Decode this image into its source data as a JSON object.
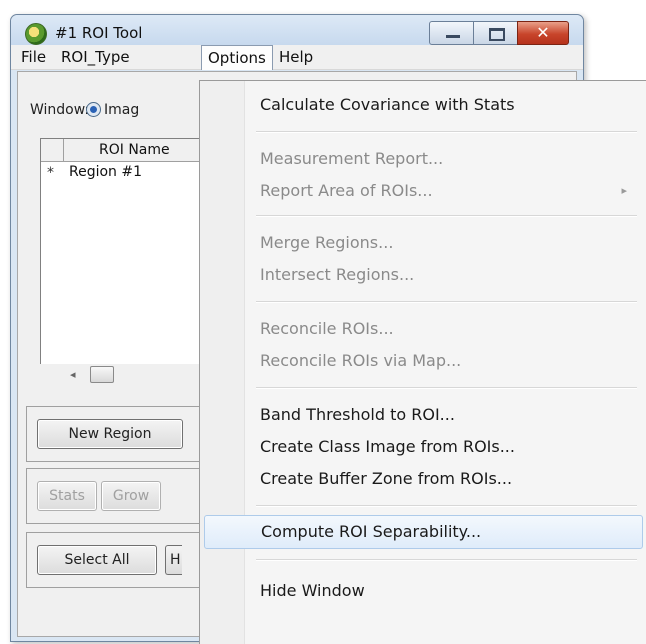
{
  "window": {
    "title": "#1 ROI Tool",
    "close_glyph": "✕"
  },
  "menubar": {
    "items": [
      "File",
      "ROI_Type",
      "Options",
      "Help"
    ],
    "active": "Options"
  },
  "panel": {
    "window_label": "Window:",
    "radio_label": "Imag",
    "grid_header": "ROI Name",
    "row_marker": "*",
    "row_name": "Region #1",
    "scroll_left_glyph": "◂",
    "buttons": {
      "new_region": "New Region",
      "stats": "Stats",
      "grow": "Grow",
      "select_all": "Select All",
      "h_stub": "H"
    }
  },
  "options_menu": {
    "items": [
      {
        "label": "Calculate Covariance with Stats",
        "enabled": true
      },
      {
        "label": "Measurement Report...",
        "enabled": false
      },
      {
        "label": "Report Area of ROIs...",
        "enabled": false,
        "submenu": true
      },
      {
        "label": "Merge Regions...",
        "enabled": false
      },
      {
        "label": "Intersect Regions...",
        "enabled": false
      },
      {
        "label": "Reconcile ROIs...",
        "enabled": false
      },
      {
        "label": "Reconcile ROIs via Map...",
        "enabled": false
      },
      {
        "label": "Band Threshold to ROI...",
        "enabled": true
      },
      {
        "label": "Create Class Image from ROIs...",
        "enabled": true
      },
      {
        "label": "Create Buffer Zone from ROIs...",
        "enabled": true
      },
      {
        "label": "Compute ROI Separability...",
        "enabled": true,
        "highlighted": true
      },
      {
        "label": "Hide Window",
        "enabled": true
      }
    ],
    "submenu_glyph": "▸"
  }
}
